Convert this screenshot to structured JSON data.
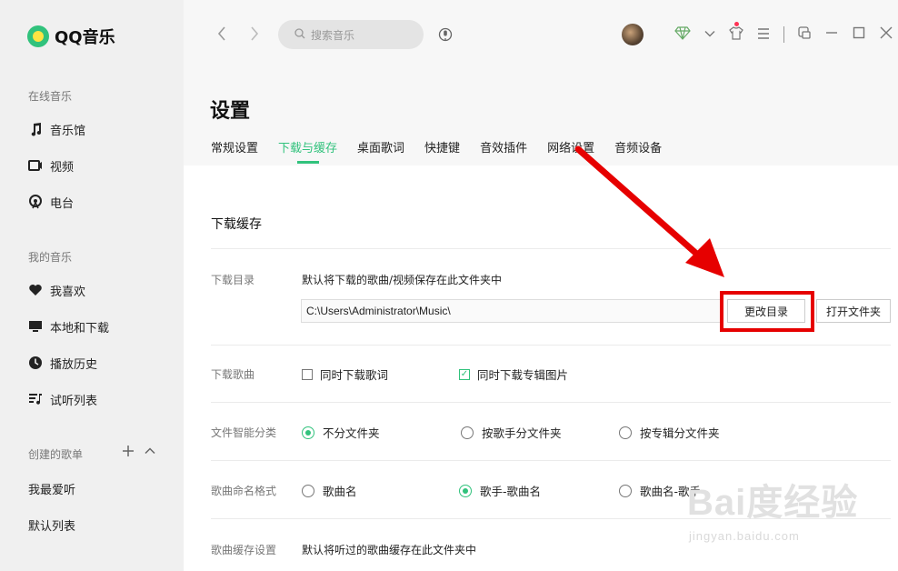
{
  "app": {
    "name": "QQ音乐"
  },
  "sidebar": {
    "online_section": "在线音乐",
    "online_items": [
      {
        "label": "音乐馆",
        "icon": "music-note-icon"
      },
      {
        "label": "视频",
        "icon": "video-icon"
      },
      {
        "label": "电台",
        "icon": "radio-icon"
      }
    ],
    "my_section": "我的音乐",
    "my_items": [
      {
        "label": "我喜欢",
        "icon": "heart-icon"
      },
      {
        "label": "本地和下载",
        "icon": "monitor-icon"
      },
      {
        "label": "播放历史",
        "icon": "clock-icon"
      },
      {
        "label": "试听列表",
        "icon": "playlist-icon"
      }
    ],
    "created_section": "创建的歌单",
    "created_lists": [
      "我最爱听",
      "默认列表"
    ]
  },
  "header": {
    "search_placeholder": "搜索音乐"
  },
  "settings": {
    "title": "设置",
    "tabs": [
      "常规设置",
      "下载与缓存",
      "桌面歌词",
      "快捷键",
      "音效插件",
      "网络设置",
      "音频设备"
    ],
    "active_tab": "下载与缓存",
    "section_title": "下载缓存",
    "download_dir": {
      "label": "下载目录",
      "desc": "默认将下载的歌曲/视频保存在此文件夹中",
      "path": "C:\\Users\\Administrator\\Music\\",
      "change_button": "更改目录",
      "open_button": "打开文件夹"
    },
    "download_song": {
      "label": "下载歌曲",
      "options": [
        {
          "label": "同时下载歌词",
          "checked": false
        },
        {
          "label": "同时下载专辑图片",
          "checked": true
        }
      ]
    },
    "smart_classify": {
      "label": "文件智能分类",
      "options": [
        {
          "label": "不分文件夹",
          "selected": true
        },
        {
          "label": "按歌手分文件夹",
          "selected": false
        },
        {
          "label": "按专辑分文件夹",
          "selected": false
        }
      ]
    },
    "naming_format": {
      "label": "歌曲命名格式",
      "options": [
        {
          "label": "歌曲名",
          "selected": false
        },
        {
          "label": "歌手-歌曲名",
          "selected": true
        },
        {
          "label": "歌曲名-歌手",
          "selected": false
        }
      ]
    },
    "cache": {
      "label": "歌曲缓存设置",
      "desc": "默认将听过的歌曲缓存在此文件夹中"
    }
  },
  "watermark": {
    "big": "Bai度经验",
    "small": "jingyan.baidu.com"
  },
  "colors": {
    "accent": "#31c27c",
    "annotation": "#e60000"
  }
}
